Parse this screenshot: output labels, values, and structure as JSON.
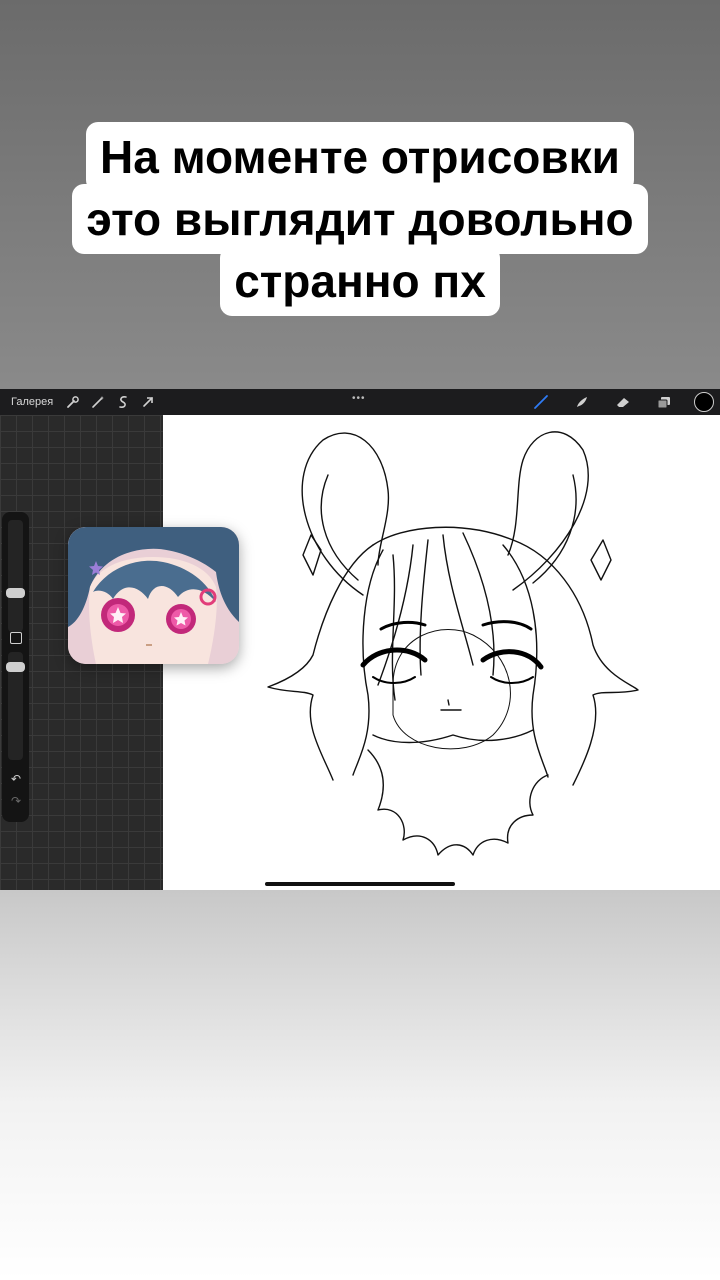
{
  "caption": {
    "lines": [
      "На моменте отрисовки",
      "это выглядит довольно",
      "странно пх"
    ]
  },
  "toolbar": {
    "gallery_label": "Галерея",
    "left_icons": [
      "wrench-icon",
      "magic-wand-icon",
      "selection-icon",
      "transform-arrow-icon"
    ],
    "more_label": "•••",
    "right_icons": [
      "brush-icon",
      "smudge-icon",
      "eraser-icon",
      "layers-icon"
    ],
    "active_tool": "brush-icon",
    "accent_color": "#2f7cf6",
    "current_color": "#000000"
  },
  "side_panel": {
    "undo_label": "↶",
    "redo_label": "↷"
  },
  "colors": {
    "canvas": "#ffffff",
    "grid_background": "#2a2a2a",
    "toolbar": "#1c1c1e"
  }
}
